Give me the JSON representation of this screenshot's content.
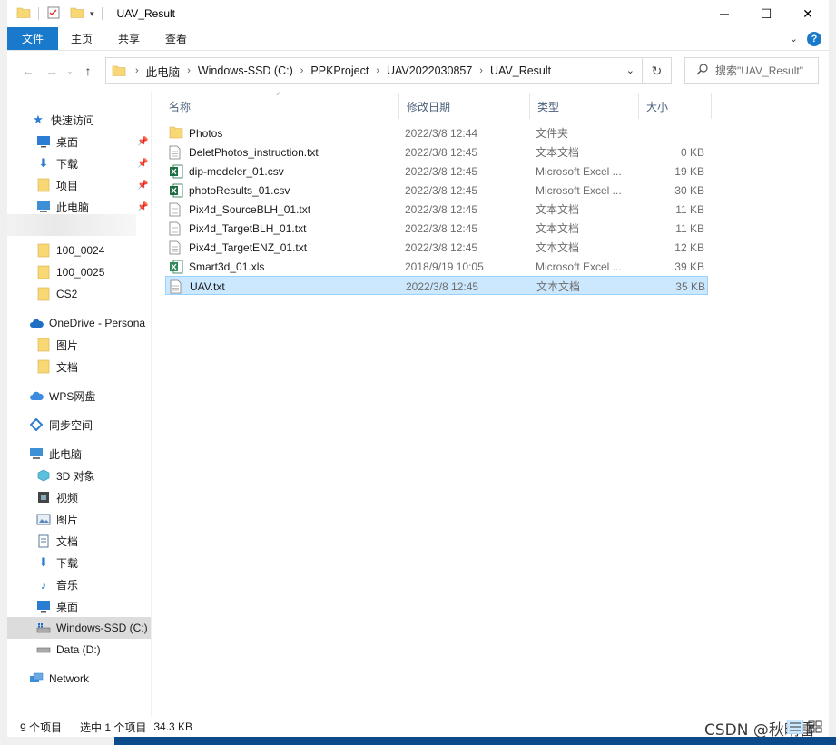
{
  "window": {
    "title": "UAV_Result"
  },
  "ribbon": {
    "tabs": [
      "文件",
      "主页",
      "共享",
      "查看"
    ]
  },
  "address": {
    "crumbs": [
      "此电脑",
      "Windows-SSD (C:)",
      "PPKProject",
      "UAV2022030857",
      "UAV_Result"
    ]
  },
  "search": {
    "placeholder": "搜索\"UAV_Result\""
  },
  "sidebar": {
    "items": [
      {
        "label": "快速访问",
        "icon": "star-icon"
      },
      {
        "label": "桌面",
        "icon": "desktop-icon",
        "pinned": true
      },
      {
        "label": "下载",
        "icon": "download-icon",
        "pinned": true
      },
      {
        "label": "项目",
        "icon": "folder-icon",
        "pinned": true
      },
      {
        "label": "此电脑",
        "icon": "pc-icon",
        "pinned": true
      },
      {
        "label": "100_0024",
        "icon": "folder-icon"
      },
      {
        "label": "100_0025",
        "icon": "folder-icon"
      },
      {
        "label": "CS2",
        "icon": "folder-icon"
      },
      {
        "label": "OneDrive - Persona",
        "icon": "cloud-icon"
      },
      {
        "label": "图片",
        "icon": "folder-icon"
      },
      {
        "label": "文档",
        "icon": "folder-icon"
      },
      {
        "label": "WPS网盘",
        "icon": "wps-cloud-icon"
      },
      {
        "label": "同步空间",
        "icon": "sync-icon"
      },
      {
        "label": "此电脑",
        "icon": "pc-icon"
      },
      {
        "label": "3D 对象",
        "icon": "cube-icon"
      },
      {
        "label": "视频",
        "icon": "video-icon"
      },
      {
        "label": "图片",
        "icon": "pictures-icon"
      },
      {
        "label": "文档",
        "icon": "documents-icon"
      },
      {
        "label": "下载",
        "icon": "download-icon"
      },
      {
        "label": "音乐",
        "icon": "music-icon"
      },
      {
        "label": "桌面",
        "icon": "desktop-icon"
      },
      {
        "label": "Windows-SSD (C:)",
        "icon": "drive-c-icon"
      },
      {
        "label": "Data (D:)",
        "icon": "drive-icon"
      },
      {
        "label": "Network",
        "icon": "network-icon"
      }
    ]
  },
  "columns": {
    "name": "名称",
    "modified": "修改日期",
    "type": "类型",
    "size": "大小"
  },
  "files": [
    {
      "name": "Photos",
      "modified": "2022/3/8 12:44",
      "type": "文件夹",
      "size": "",
      "icon": "folder-icon"
    },
    {
      "name": "DeletPhotos_instruction.txt",
      "modified": "2022/3/8 12:45",
      "type": "文本文档",
      "size": "0 KB",
      "icon": "text-file-icon"
    },
    {
      "name": "dip-modeler_01.csv",
      "modified": "2022/3/8 12:45",
      "type": "Microsoft Excel ...",
      "size": "19 KB",
      "icon": "excel-icon"
    },
    {
      "name": "photoResults_01.csv",
      "modified": "2022/3/8 12:45",
      "type": "Microsoft Excel ...",
      "size": "30 KB",
      "icon": "excel-icon"
    },
    {
      "name": "Pix4d_SourceBLH_01.txt",
      "modified": "2022/3/8 12:45",
      "type": "文本文档",
      "size": "11 KB",
      "icon": "text-file-icon"
    },
    {
      "name": "Pix4d_TargetBLH_01.txt",
      "modified": "2022/3/8 12:45",
      "type": "文本文档",
      "size": "11 KB",
      "icon": "text-file-icon"
    },
    {
      "name": "Pix4d_TargetENZ_01.txt",
      "modified": "2022/3/8 12:45",
      "type": "文本文档",
      "size": "12 KB",
      "icon": "text-file-icon"
    },
    {
      "name": "Smart3d_01.xls",
      "modified": "2018/9/19 10:05",
      "type": "Microsoft Excel ...",
      "size": "39 KB",
      "icon": "excel-xls-icon"
    },
    {
      "name": "UAV.txt",
      "modified": "2022/3/8 12:45",
      "type": "文本文档",
      "size": "35 KB",
      "icon": "text-file-icon",
      "selected": true
    }
  ],
  "status": {
    "count": "9 个项目",
    "selection": "选中 1 个项目",
    "selection_size": "34.3 KB"
  },
  "watermark": "CSDN @秋晴雷",
  "colors": {
    "accent": "#1979ca",
    "selection": "#cce8ff",
    "folder": "#f8d775"
  }
}
